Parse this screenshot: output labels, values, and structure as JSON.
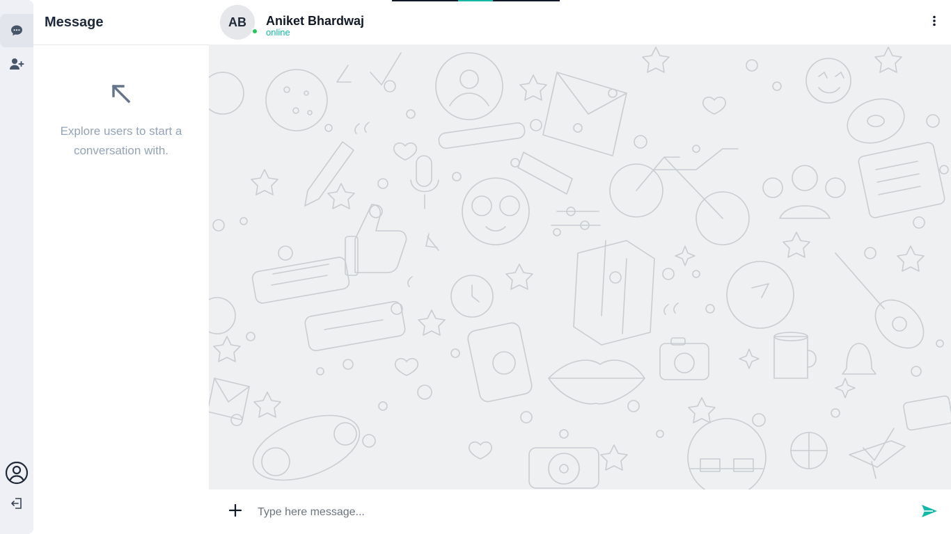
{
  "rail": {
    "items": [
      {
        "name": "chats",
        "icon": "chat-bubble-icon",
        "active": true
      },
      {
        "name": "add-user",
        "icon": "user-plus-icon",
        "active": false
      }
    ],
    "bottom": [
      {
        "name": "profile",
        "icon": "user-circle-icon"
      },
      {
        "name": "logout",
        "icon": "logout-icon"
      }
    ]
  },
  "sidebar": {
    "title": "Message",
    "empty_state": {
      "icon": "arrow-up-left-icon",
      "text": "Explore users to start a conversation with."
    }
  },
  "chat": {
    "contact": {
      "initials": "AB",
      "name": "Aniket Bhardwaj",
      "status": "online"
    },
    "menu_icon": "more-vertical-icon"
  },
  "composer": {
    "attach_icon": "plus-icon",
    "placeholder": "Type here message...",
    "send_icon": "send-icon"
  },
  "colors": {
    "accent": "#14b8a6",
    "online": "#22c55e",
    "rail_bg": "#eef0f5",
    "wallpaper_bg": "#eff0f2",
    "doodle_stroke": "#c9ccd1"
  }
}
